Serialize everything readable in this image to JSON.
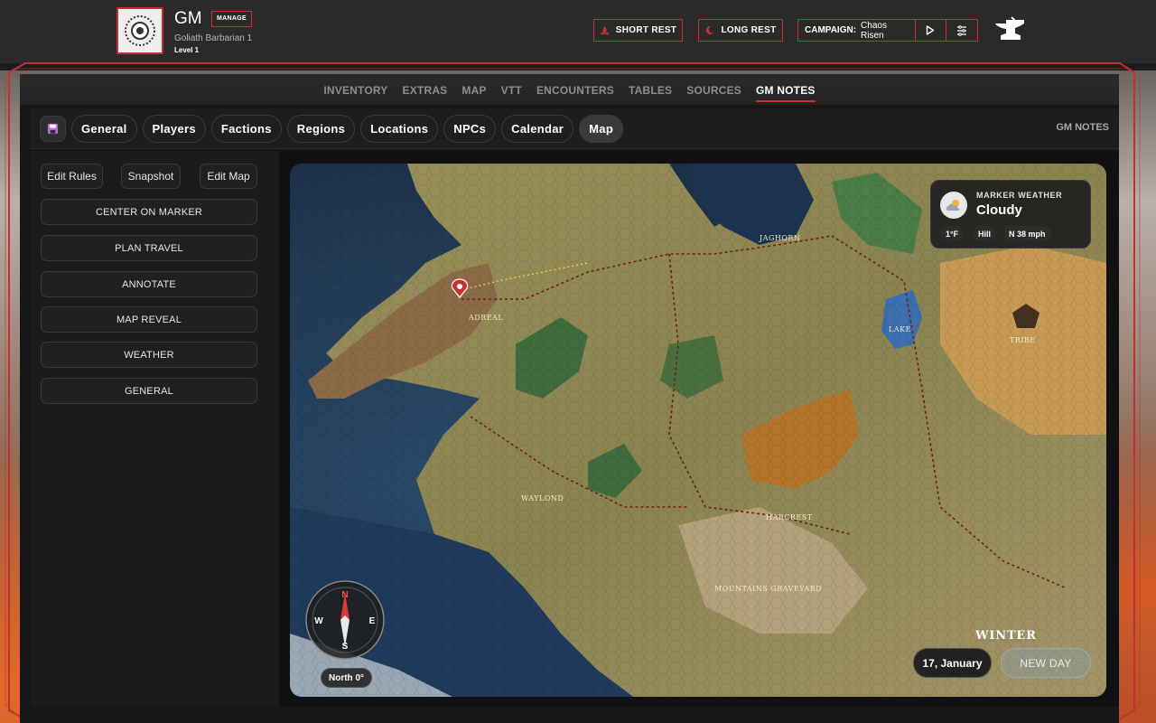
{
  "header": {
    "character_name": "GM",
    "manage_label": "MANAGE",
    "character_class": "Goliath  Barbarian 1",
    "character_level": "Level 1",
    "short_rest_label": "SHORT REST",
    "long_rest_label": "LONG REST",
    "campaign_label": "CAMPAIGN:",
    "campaign_name": "Chaos Risen"
  },
  "nav": {
    "items": [
      "INVENTORY",
      "EXTRAS",
      "MAP",
      "VTT",
      "ENCOUNTERS",
      "TABLES",
      "SOURCES",
      "GM NOTES"
    ],
    "active": "GM NOTES"
  },
  "subnav": {
    "tabs": [
      "General",
      "Players",
      "Factions",
      "Regions",
      "Locations",
      "NPCs",
      "Calendar",
      "Map"
    ],
    "active": "Map",
    "section_title": "GM NOTES"
  },
  "sidebar": {
    "edit_rules": "Edit Rules",
    "snapshot": "Snapshot",
    "edit_map": "Edit Map",
    "actions": [
      "CENTER ON MARKER",
      "PLAN TRAVEL",
      "ANNOTATE",
      "MAP REVEAL",
      "WEATHER",
      "GENERAL"
    ]
  },
  "map": {
    "weather": {
      "title": "MARKER WEATHER",
      "condition": "Cloudy",
      "temperature": "1°F",
      "terrain": "Hill",
      "wind": "N 38 mph"
    },
    "compass": {
      "n": "N",
      "s": "S",
      "e": "E",
      "w": "W",
      "heading": "North 0°"
    },
    "season": "WINTER",
    "date": "17, January",
    "new_day_label": "NEW DAY",
    "place_labels": [
      "ADREAL",
      "JAGHORN",
      "WAYLOND",
      "HARCREST",
      "LAKE",
      "MOUNTAINS GRAVEYARD",
      "TRIBE"
    ]
  },
  "colors": {
    "accent": "#c53131",
    "panel": "#171717",
    "header": "#2a2a2b"
  }
}
